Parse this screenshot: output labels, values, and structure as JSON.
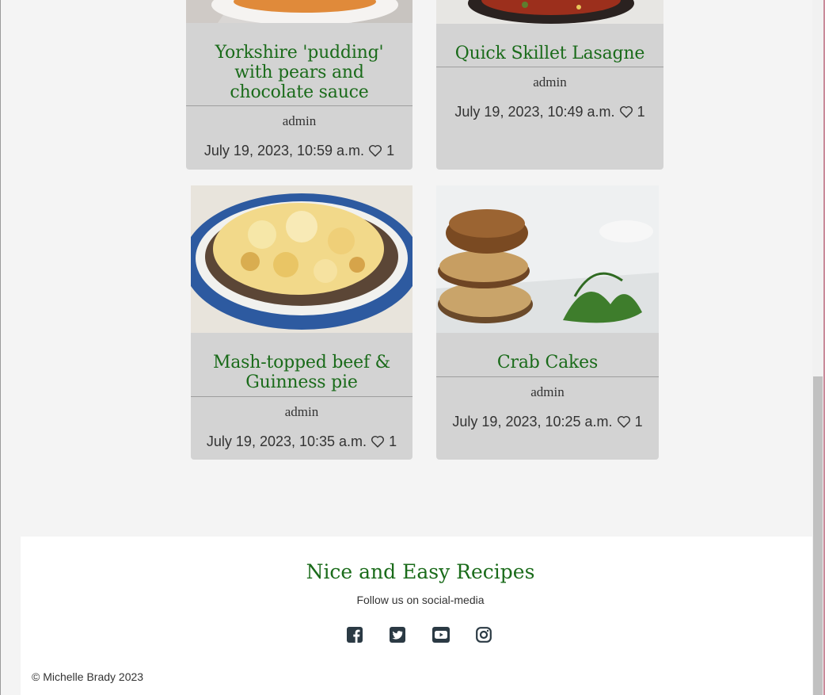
{
  "posts": [
    {
      "title": "Yorkshire 'pudding' with pears and chocolate sauce",
      "author": "admin",
      "date": "July 19, 2023, 10:59 a.m.",
      "likes": "1"
    },
    {
      "title": "Quick Skillet Lasagne",
      "author": "admin",
      "date": "July 19, 2023, 10:49 a.m.",
      "likes": "1"
    },
    {
      "title": "Mash-topped beef & Guinness pie",
      "author": "admin",
      "date": "July 19, 2023, 10:35 a.m.",
      "likes": "1"
    },
    {
      "title": "Crab Cakes",
      "author": "admin",
      "date": "July 19, 2023, 10:25 a.m.",
      "likes": "1"
    }
  ],
  "footer": {
    "brand": "Nice and Easy Recipes",
    "follow": "Follow us on social-media",
    "social_icons": [
      "facebook-icon",
      "twitter-icon",
      "youtube-icon",
      "instagram-icon"
    ],
    "copyright": "© Michelle Brady 2023"
  },
  "colors": {
    "title_green": "#1a6b1a",
    "card_bg": "#d3d3d3",
    "page_bg": "#f4f4f4"
  }
}
